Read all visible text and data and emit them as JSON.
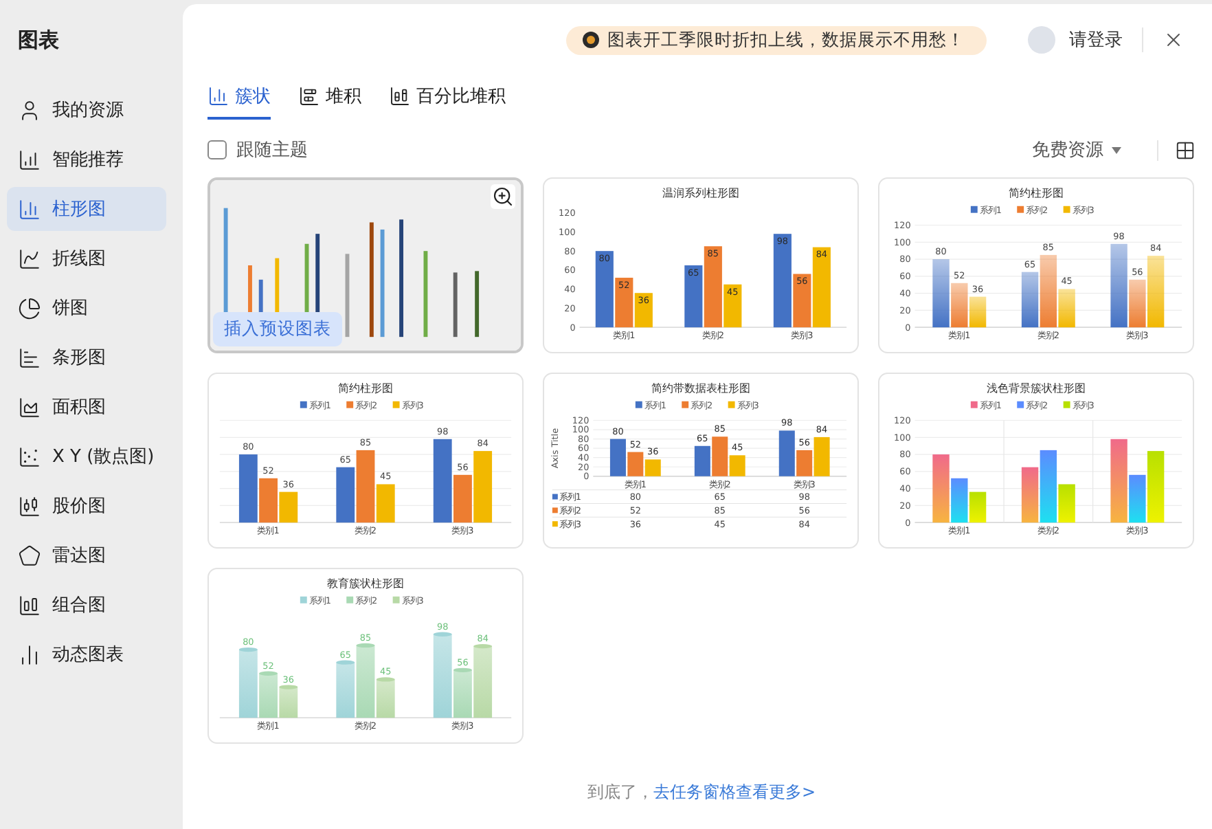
{
  "sidebar": {
    "title": "图表",
    "items": [
      {
        "label": "我的资源",
        "selected": false
      },
      {
        "label": "智能推荐",
        "selected": false
      },
      {
        "label": "柱形图",
        "selected": true
      },
      {
        "label": "折线图",
        "selected": false
      },
      {
        "label": "饼图",
        "selected": false
      },
      {
        "label": "条形图",
        "selected": false
      },
      {
        "label": "面积图",
        "selected": false
      },
      {
        "label": "X Y (散点图)",
        "selected": false
      },
      {
        "label": "股价图",
        "selected": false
      },
      {
        "label": "雷达图",
        "selected": false
      },
      {
        "label": "组合图",
        "selected": false
      },
      {
        "label": "动态图表",
        "selected": false
      }
    ]
  },
  "header": {
    "banner": "图表开工季限时折扣上线，数据展示不用愁！",
    "login": "请登录"
  },
  "tabs": [
    {
      "label": "簇状",
      "selected": true
    },
    {
      "label": "堆积",
      "selected": false
    },
    {
      "label": "百分比堆积",
      "selected": false
    }
  ],
  "follow_theme": {
    "label": "跟随主题",
    "checked": false
  },
  "filter": {
    "label": "免费资源"
  },
  "cards": [
    {
      "kind": "picture",
      "hovered": true,
      "insert_label": "插入预设图表"
    },
    {
      "kind": "warm",
      "hovered": false,
      "chart_data": {
        "type": "bar",
        "title": "温润系列柱形图",
        "categories": [
          "类别1",
          "类别2",
          "类别3"
        ],
        "series": [
          {
            "color": "#4472c4",
            "values": [
              80,
              65,
              98
            ]
          },
          {
            "color": "#ed7d31",
            "values": [
              52,
              85,
              56
            ]
          },
          {
            "color": "#f2b800",
            "values": [
              36,
              45,
              84
            ]
          }
        ],
        "ylim": [
          0,
          120
        ],
        "yticks": [
          0,
          20,
          40,
          60,
          80,
          100,
          120
        ],
        "value_labels": [
          [
            "80",
            "65",
            "98"
          ],
          [
            "52",
            "85",
            "56"
          ],
          [
            "36",
            "45",
            "84"
          ]
        ]
      }
    },
    {
      "kind": "gradient",
      "hovered": false,
      "chart_data": {
        "type": "bar",
        "title": "简约柱形图",
        "categories": [
          "类别1",
          "类别2",
          "类别3"
        ],
        "series": [
          {
            "name": "系列1",
            "color": "#4472c4",
            "values": [
              80,
              65,
              98
            ]
          },
          {
            "name": "系列2",
            "color": "#ed7d31",
            "values": [
              52,
              85,
              56
            ]
          },
          {
            "name": "系列3",
            "color": "#f2b800",
            "values": [
              36,
              45,
              84
            ]
          }
        ],
        "ylim": [
          0,
          120
        ],
        "yticks": [
          0,
          20,
          40,
          60,
          80,
          100,
          120
        ],
        "data_labels": true,
        "grid": true,
        "legend": true
      }
    },
    {
      "kind": "plain",
      "hovered": false,
      "chart_data": {
        "type": "bar",
        "title": "简约柱形图",
        "categories": [
          "类别1",
          "类别2",
          "类别3"
        ],
        "series": [
          {
            "name": "系列1",
            "color": "#4472c4",
            "values": [
              80,
              65,
              98
            ]
          },
          {
            "name": "系列2",
            "color": "#ed7d31",
            "values": [
              52,
              85,
              56
            ]
          },
          {
            "name": "系列3",
            "color": "#f2b800",
            "values": [
              36,
              45,
              84
            ]
          }
        ],
        "data_labels": true,
        "grid": true,
        "legend": true
      }
    },
    {
      "kind": "table",
      "hovered": false,
      "chart_data": {
        "type": "bar",
        "title": "简约带数据表柱形图",
        "ylabel": "Axis Title",
        "categories": [
          "类别1",
          "类别2",
          "类别3"
        ],
        "series": [
          {
            "name": "系列1",
            "color": "#4472c4",
            "values": [
              80,
              65,
              98
            ]
          },
          {
            "name": "系列2",
            "color": "#ed7d31",
            "values": [
              52,
              85,
              56
            ]
          },
          {
            "name": "系列3",
            "color": "#f2b800",
            "values": [
              36,
              45,
              84
            ]
          }
        ],
        "ylim": [
          0,
          120
        ],
        "yticks": [
          0,
          20,
          40,
          60,
          80,
          100,
          120
        ],
        "value_labels": [
          [
            "80",
            "65",
            "98"
          ],
          [
            "52",
            "85",
            "56"
          ],
          [
            "36",
            "45",
            "84"
          ]
        ],
        "grid": true,
        "legend": true
      },
      "data_table": [
        {
          "label": "系列1",
          "cells": [
            "80",
            "65",
            "98"
          ]
        },
        {
          "label": "系列2",
          "cells": [
            "52",
            "85",
            "56"
          ]
        },
        {
          "label": "系列3",
          "cells": [
            "36",
            "45",
            "84"
          ]
        }
      ]
    },
    {
      "kind": "light",
      "hovered": false,
      "chart_data": {
        "type": "bar",
        "title": "浅色背景簇状柱形图",
        "categories": [
          "类别1",
          "类别2",
          "类别3"
        ],
        "series": [
          {
            "name": "系列1",
            "color": "#f06a8a",
            "values": [
              80,
              65,
              98
            ]
          },
          {
            "name": "系列2",
            "color": "#5b8cff",
            "values": [
              52,
              85,
              56
            ]
          },
          {
            "name": "系列3",
            "color": "#b8e000",
            "values": [
              36,
              45,
              84
            ]
          }
        ],
        "ylim": [
          0,
          120
        ],
        "yticks": [
          0,
          20,
          40,
          60,
          80,
          100,
          120
        ],
        "grid": true,
        "legend": true
      }
    },
    {
      "kind": "edu",
      "hovered": false,
      "chart_data": {
        "type": "bar",
        "title": "教育簇状柱形图",
        "categories": [
          "类别1",
          "类别2",
          "类别3"
        ],
        "series": [
          {
            "name": "系列1",
            "color": "#9fd4d8",
            "values": [
              80,
              65,
              98
            ]
          },
          {
            "name": "系列2",
            "color": "#a9d9b4",
            "values": [
              52,
              85,
              56
            ]
          },
          {
            "name": "系列3",
            "color": "#b8d9a6",
            "values": [
              36,
              45,
              84
            ]
          }
        ],
        "data_labels": true,
        "legend": true
      }
    }
  ],
  "footer": {
    "text": "到底了，",
    "link": "去任务窗格查看更多>"
  }
}
